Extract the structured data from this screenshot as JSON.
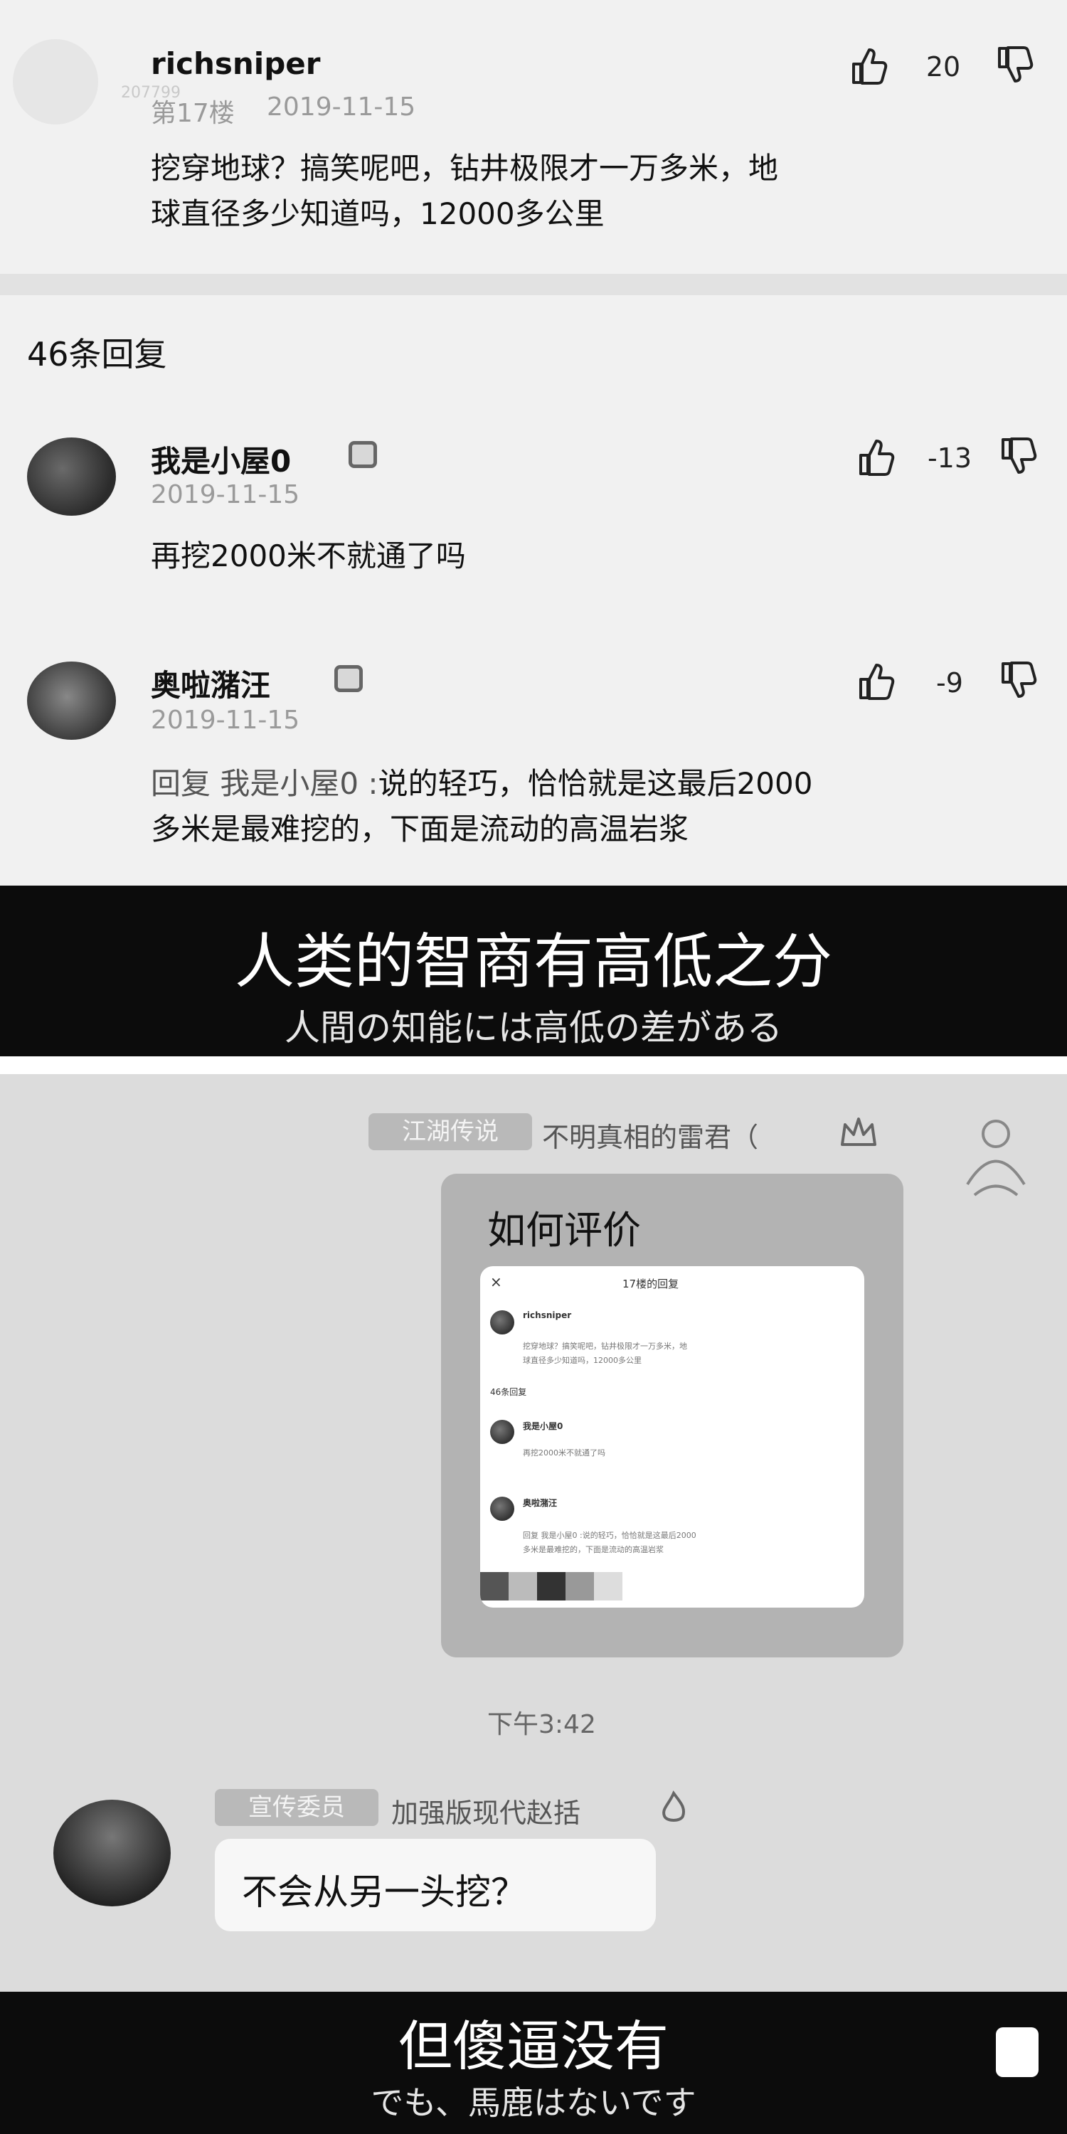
{
  "top": {
    "comment": {
      "username": "richsniper",
      "watermark": "207799",
      "floor": "第17楼",
      "date": "2019-11-15",
      "likes": "20",
      "text_line1": "挖穿地球？搞笑呢吧，钻井极限才一万多米，地",
      "text_line2": "球直径多少知道吗，12000多公里"
    },
    "replies_header": "46条回复",
    "replies": [
      {
        "username": "我是小屋0",
        "date": "2019-11-15",
        "likes": "-13",
        "text": "再挖2000米不就通了吗"
      },
      {
        "username": "奥啦潴汪",
        "date": "2019-11-15",
        "likes": "-9",
        "reply_prefix": "回复 我是小屋0 :",
        "text_line1": "说的轻巧，恰恰就是这最后2000",
        "text_line2": "多米是最难挖的，下面是流动的高温岩浆"
      }
    ],
    "caption_zh": "人类的智商有高低之分",
    "caption_ja": "人間の知能には高低の差がある"
  },
  "bottom": {
    "msg1": {
      "tag": "江湖传说",
      "sender": "不明真相的雷君（",
      "text": "如何评价"
    },
    "mini": {
      "title": "17楼的回复",
      "close": "×",
      "username": "richsniper",
      "text_line1": "挖穿地球？搞笑呢吧，钻井极限才一万多米，地",
      "text_line2": "球直径多少知道吗，12000多公里",
      "header": "46条回复",
      "reply1_user": "我是小屋0",
      "reply1_text": "再挖2000米不就通了吗",
      "reply2_user": "奥啦潴汪",
      "reply2_line1": "回复 我是小屋0 :说的轻巧，恰恰就是这最后2000",
      "reply2_line2": "多米是最难挖的，下面是流动的高温岩浆"
    },
    "time": "下午3:42",
    "msg2": {
      "tag": "宣传委员",
      "sender": "加强版现代赵括",
      "text": "不会从另一头挖？"
    },
    "caption_zh": "但傻逼没有",
    "caption_ja": "でも、馬鹿はないです"
  }
}
